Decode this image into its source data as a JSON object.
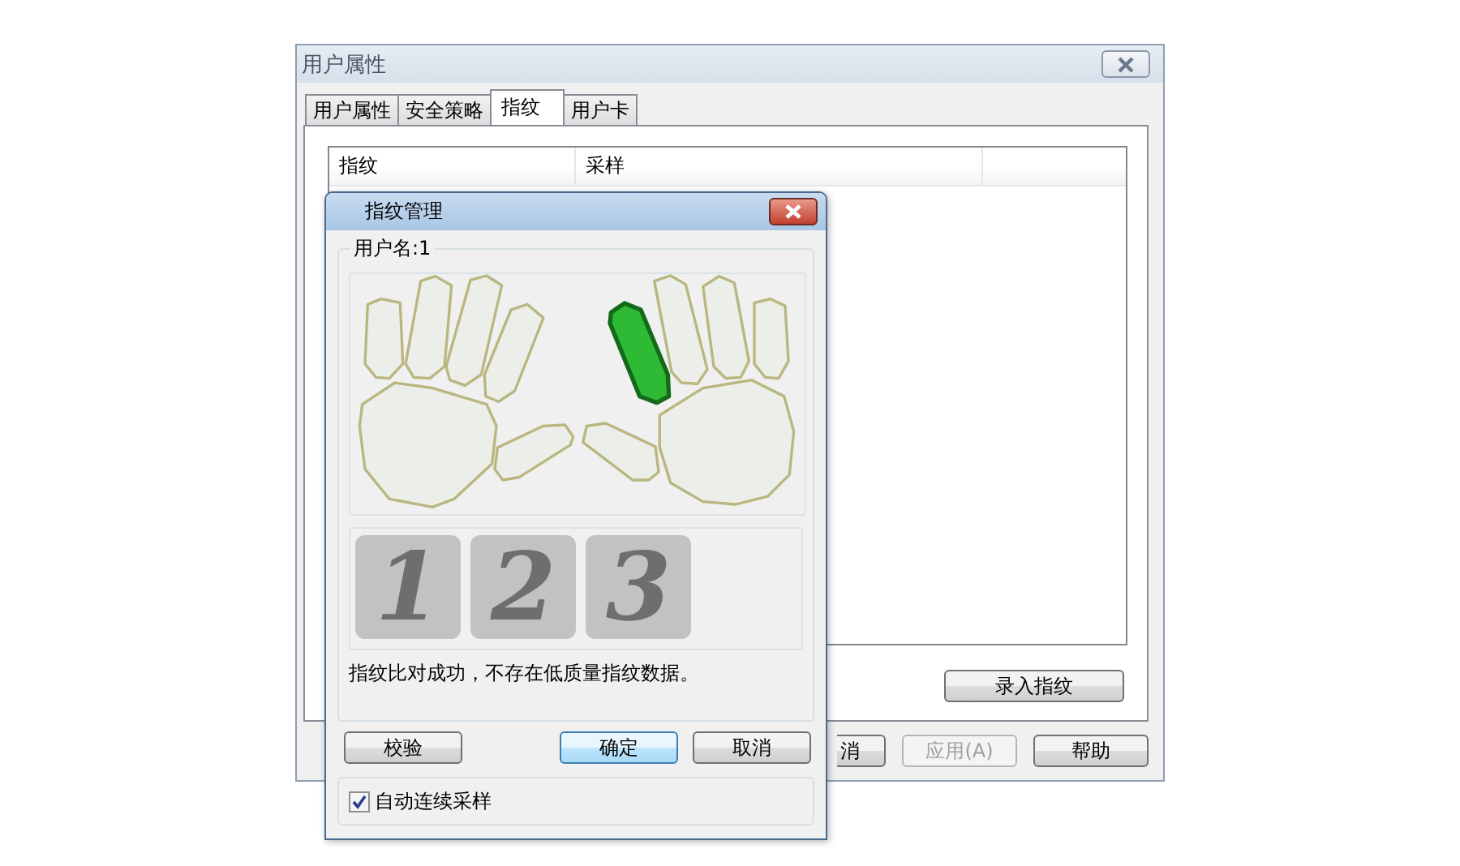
{
  "main_window": {
    "title": "用户属性",
    "tabs": [
      {
        "label": "用户属性",
        "selected": false
      },
      {
        "label": "安全策略",
        "selected": false
      },
      {
        "label": "指纹",
        "selected": true
      },
      {
        "label": "用户卡",
        "selected": false
      }
    ],
    "table": {
      "columns": [
        "指纹",
        "采样"
      ]
    },
    "enroll_button": "录入指纹",
    "buttons": [
      {
        "label": "消",
        "disabled": false
      },
      {
        "label": "应用(A)",
        "disabled": true
      },
      {
        "label": "帮助",
        "disabled": false
      }
    ]
  },
  "dialog": {
    "title": "指纹管理",
    "group_label": "用户名:1",
    "fingers": [
      {
        "selected": false
      },
      {
        "selected": false
      },
      {
        "selected": false
      },
      {
        "selected": false
      },
      {
        "selected": false
      },
      {
        "selected": false
      },
      {
        "selected": true
      },
      {
        "selected": false
      },
      {
        "selected": false
      },
      {
        "selected": false
      }
    ],
    "samples": [
      "1",
      "2",
      "3"
    ],
    "message": "指纹比对成功，不存在低质量指纹数据。",
    "buttons": [
      {
        "label": "校验",
        "default": false
      },
      {
        "label": "确定",
        "default": true
      },
      {
        "label": "取消",
        "default": false
      }
    ],
    "auto_sample": {
      "label": "自动连续采样",
      "checked": true
    }
  }
}
